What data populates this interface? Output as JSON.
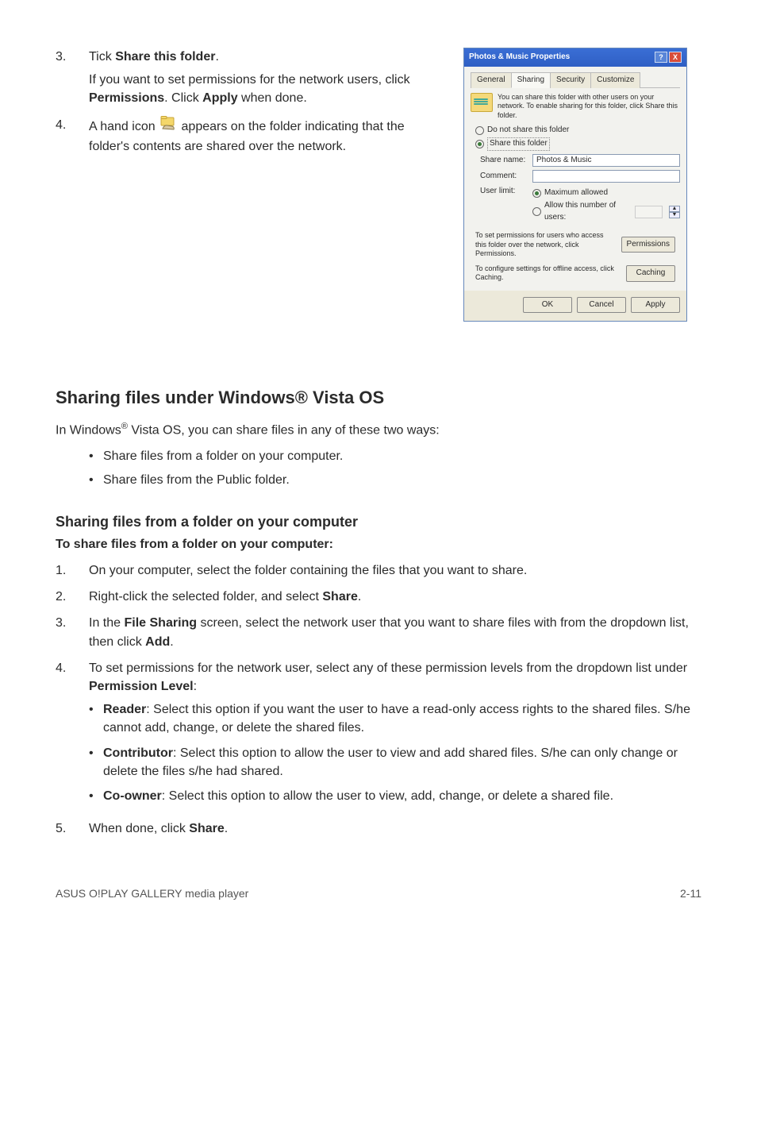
{
  "steps_top": {
    "s3_num": "3.",
    "s3_line1_a": "Tick ",
    "s3_line1_b": "Share this folder",
    "s3_line1_c": ".",
    "s3_para_a": "If you want to set permissions for the network users, click ",
    "s3_para_b": "Permissions",
    "s3_para_c": ". Click ",
    "s3_para_d": "Apply",
    "s3_para_e": " when done.",
    "s4_num": "4.",
    "s4_a": "A hand icon ",
    "s4_b": " appears on the folder indicating that the folder's contents are shared over the network."
  },
  "dialog": {
    "title": "Photos & Music Properties",
    "help": "?",
    "close": "X",
    "tab_general": "General",
    "tab_sharing": "Sharing",
    "tab_security": "Security",
    "tab_customize": "Customize",
    "info_text": "You can share this folder with other users on your network. To enable sharing for this folder, click Share this folder.",
    "opt_do_not": "Do not share this folder",
    "opt_share": "Share this folder",
    "lbl_share_name": "Share name:",
    "val_share_name": "Photos & Music",
    "lbl_comment": "Comment:",
    "lbl_user_limit": "User limit:",
    "opt_max": "Maximum allowed",
    "opt_allow_num": "Allow this number of users:",
    "perm_text": "To set permissions for users who access this folder over the network, click Permissions.",
    "btn_permissions": "Permissions",
    "cache_text": "To configure settings for offline access, click Caching.",
    "btn_caching": "Caching",
    "btn_ok": "OK",
    "btn_cancel": "Cancel",
    "btn_apply": "Apply"
  },
  "section": {
    "title": "Sharing files under Windows® Vista OS",
    "intro_a": "In Windows",
    "intro_b": " Vista OS, you can share files in any of these two ways:",
    "bul1": "Share files from a folder on your computer.",
    "bul2": "Share files from the Public folder."
  },
  "share_folder": {
    "heading": "Sharing files from a folder on your computer",
    "lead": "To share files from a folder on your computer:",
    "n1": "1.",
    "t1": "On your computer, select the folder containing the files that you want to share.",
    "n2": "2.",
    "t2_a": "Right-click the selected folder, and select ",
    "t2_b": "Share",
    "t2_c": ".",
    "n3": "3.",
    "t3_a": "In the ",
    "t3_b": "File Sharing",
    "t3_c": " screen, select the network user that you want to share files with from the dropdown list, then click ",
    "t3_d": "Add",
    "t3_e": ".",
    "n4": "4.",
    "t4_a": "To set permissions for the network user, select any of these permission levels from the dropdown list under ",
    "t4_b": "Permission Level",
    "t4_c": ":",
    "b_reader_a": "Reader",
    "b_reader_b": ": Select this option if you want the user to have a read-only access rights to the shared files. S/he cannot add, change, or delete the shared files.",
    "b_contrib_a": "Contributor",
    "b_contrib_b": ": Select this option to allow the user to view and add shared files. S/he can only change or delete the files s/he had shared.",
    "b_coowner_a": "Co-owner",
    "b_coowner_b": ": Select this option to allow the user to view, add, change, or delete a shared file.",
    "n5": "5.",
    "t5_a": "When done, click ",
    "t5_b": "Share",
    "t5_c": "."
  },
  "footer": {
    "left": "ASUS O!PLAY GALLERY media player",
    "right": "2-11"
  }
}
